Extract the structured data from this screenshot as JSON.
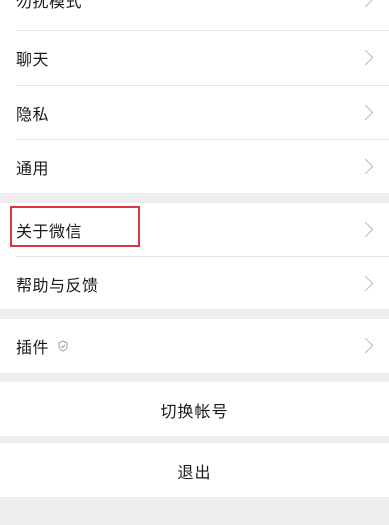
{
  "settings": {
    "items": [
      {
        "label": "勿扰模式"
      },
      {
        "label": "聊天"
      },
      {
        "label": "隐私"
      },
      {
        "label": "通用"
      },
      {
        "label": "关于微信"
      },
      {
        "label": "帮助与反馈"
      },
      {
        "label": "插件"
      }
    ],
    "switch_account": "切换帐号",
    "logout": "退出"
  },
  "colors": {
    "background": "#ededed",
    "highlight": "#d8373c",
    "chevron": "#b7b7b7"
  }
}
